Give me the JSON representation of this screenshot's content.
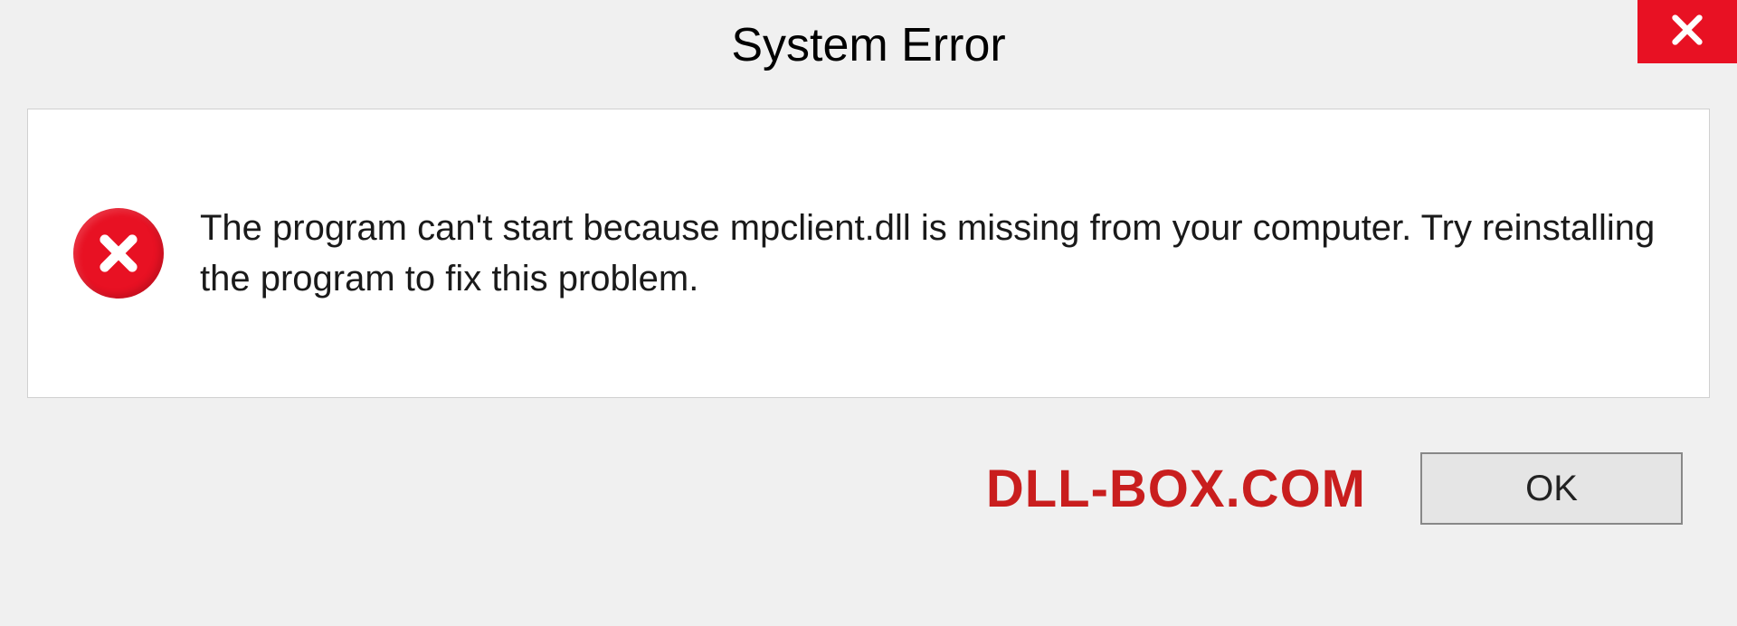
{
  "dialog": {
    "title": "System Error",
    "message": "The program can't start because mpclient.dll is missing from your computer. Try reinstalling the program to fix this problem.",
    "ok_label": "OK"
  },
  "watermark": "DLL-BOX.COM",
  "colors": {
    "close_bg": "#e81123",
    "error_icon": "#e81123",
    "watermark": "#c91e1e"
  }
}
